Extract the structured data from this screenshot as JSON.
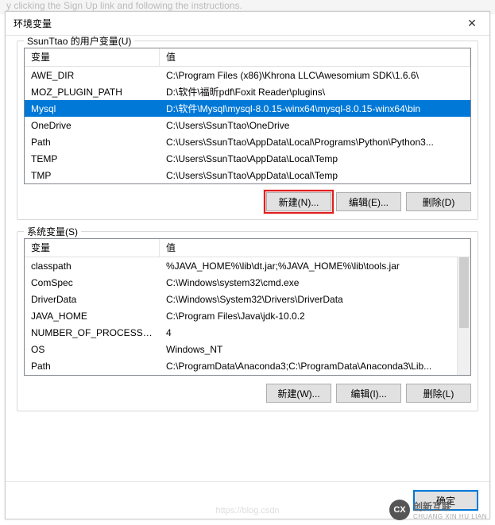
{
  "faded_bg_text": "y clicking the Sign Up link and following the instructions.",
  "dialog": {
    "title": "环境变量",
    "close_glyph": "✕"
  },
  "user_group": {
    "label": "SsunTtao 的用户变量(U)",
    "columns": {
      "var": "变量",
      "val": "值"
    },
    "rows": [
      {
        "var": "AWE_DIR",
        "val": "C:\\Program Files (x86)\\Khrona LLC\\Awesomium SDK\\1.6.6\\"
      },
      {
        "var": "MOZ_PLUGIN_PATH",
        "val": "D:\\软件\\福昕pdf\\Foxit Reader\\plugins\\"
      },
      {
        "var": "Mysql",
        "val": "D:\\软件\\Mysql\\mysql-8.0.15-winx64\\mysql-8.0.15-winx64\\bin",
        "selected": true
      },
      {
        "var": "OneDrive",
        "val": "C:\\Users\\SsunTtao\\OneDrive"
      },
      {
        "var": "Path",
        "val": "C:\\Users\\SsunTtao\\AppData\\Local\\Programs\\Python\\Python3..."
      },
      {
        "var": "TEMP",
        "val": "C:\\Users\\SsunTtao\\AppData\\Local\\Temp"
      },
      {
        "var": "TMP",
        "val": "C:\\Users\\SsunTtao\\AppData\\Local\\Temp"
      }
    ],
    "buttons": {
      "new": "新建(N)...",
      "edit": "编辑(E)...",
      "delete": "删除(D)"
    }
  },
  "sys_group": {
    "label": "系统变量(S)",
    "columns": {
      "var": "变量",
      "val": "值"
    },
    "rows": [
      {
        "var": "classpath",
        "val": "%JAVA_HOME%\\lib\\dt.jar;%JAVA_HOME%\\lib\\tools.jar"
      },
      {
        "var": "ComSpec",
        "val": "C:\\Windows\\system32\\cmd.exe"
      },
      {
        "var": "DriverData",
        "val": "C:\\Windows\\System32\\Drivers\\DriverData"
      },
      {
        "var": "JAVA_HOME",
        "val": "C:\\Program Files\\Java\\jdk-10.0.2"
      },
      {
        "var": "NUMBER_OF_PROCESSORS",
        "val": "4"
      },
      {
        "var": "OS",
        "val": "Windows_NT"
      },
      {
        "var": "Path",
        "val": "C:\\ProgramData\\Anaconda3;C:\\ProgramData\\Anaconda3\\Lib..."
      }
    ],
    "buttons": {
      "new": "新建(W)...",
      "edit": "编辑(I)...",
      "delete": "删除(L)"
    }
  },
  "footer": {
    "ok": "确定"
  },
  "watermark": {
    "brand": "创新互联",
    "sub": "CHUANG XIN HU LIAN",
    "faded_url": "https://blog.csdn"
  }
}
